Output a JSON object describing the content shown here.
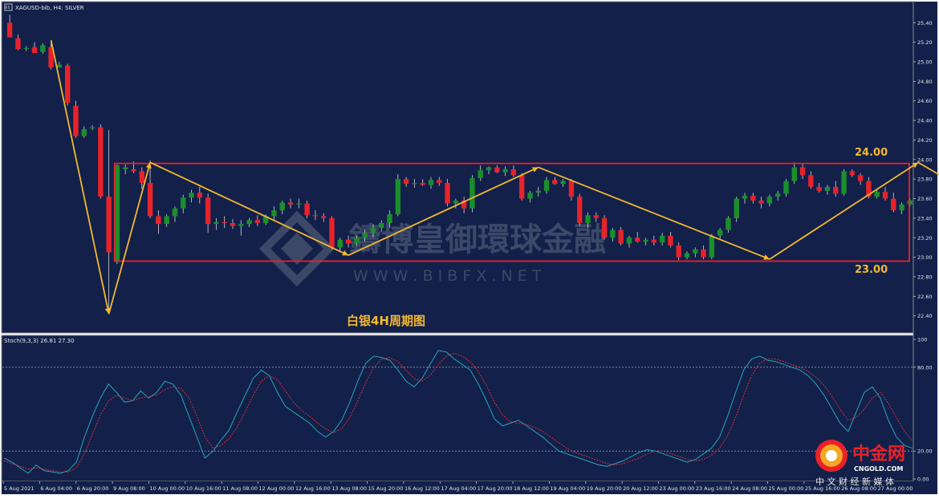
{
  "window": {
    "symbol_line": "XAGUSD-bib, H4:  SILVER",
    "stoch_line": "Stoch(9,3,3) 26.81 27.30"
  },
  "annotations": {
    "upper_label": "24.00",
    "lower_label": "23.00",
    "chart_title": "白银4H周期图"
  },
  "watermark": {
    "brand": "鑄博皇御環球金融",
    "url": "W W W . B I B F X . N E T"
  },
  "logo": {
    "name": "中金网",
    "domain": "CNGOLD.COM",
    "tagline": "中 文 财 经 新 媒 体"
  },
  "colors": {
    "background": "#12204a",
    "grid_dot": "#c8c8c8",
    "bull_candle": "#1a8f2a",
    "bear_candle": "#e8222a",
    "range_box": "#e8222a",
    "zigzag": "#f5b82e",
    "stoch_main": "#2aa6b8",
    "stoch_signal": "#d9323a"
  },
  "chart_data": [
    {
      "type": "candlestick",
      "title": "白银4H周期图",
      "symbol": "XAGUSD-bib, H4:  SILVER",
      "ylim": [
        22.25,
        25.55
      ],
      "y_ticks": [
        "25.40",
        "25.20",
        "25.00",
        "24.80",
        "24.60",
        "24.40",
        "24.20",
        "24.00",
        "23.80",
        "23.60",
        "23.40",
        "23.20",
        "23.00",
        "22.80",
        "22.60",
        "22.40"
      ],
      "x_tick_labels": [
        "5 Aug 2021",
        "6 Aug 04:00",
        "6 Aug 20:00",
        "9 Aug 08:00",
        "10 Aug 00:00",
        "10 Aug 16:00",
        "11 Aug 08:00",
        "12 Aug 00:00",
        "12 Aug 16:00",
        "13 Aug 08:00",
        "15 Aug 20:00",
        "16 Aug 12:00",
        "17 Aug 04:00",
        "17 Aug 20:00",
        "18 Aug 12:00",
        "19 Aug 04:00",
        "19 Aug 20:00",
        "20 Aug 12:00",
        "23 Aug 00:00",
        "23 Aug 16:00",
        "24 Aug 08:00",
        "25 Aug 00:00",
        "25 Aug 16:00",
        "26 Aug 08:00",
        "27 Aug 00:00"
      ],
      "range_box": {
        "high": 23.96,
        "low": 22.96
      },
      "levels": [
        {
          "label": "24.00",
          "value": 24.0
        },
        {
          "label": "23.00",
          "value": 23.0
        }
      ],
      "zigzag": [
        {
          "bar": 5,
          "price": 25.22
        },
        {
          "bar": 12,
          "price": 22.42
        },
        {
          "bar": 17,
          "price": 23.97
        },
        {
          "bar": 41,
          "price": 23.02
        },
        {
          "bar": 64,
          "price": 23.92
        },
        {
          "bar": 92,
          "price": 22.98
        },
        {
          "bar": 110,
          "price": 23.97
        },
        {
          "bar": 130,
          "price": 22.98
        },
        {
          "bar": 135,
          "price": 23.75
        }
      ],
      "candles": [
        {
          "o": 25.4,
          "h": 25.48,
          "l": 25.25,
          "c": 25.25
        },
        {
          "o": 25.24,
          "h": 25.28,
          "l": 25.12,
          "c": 25.13
        },
        {
          "o": 25.14,
          "h": 25.16,
          "l": 25.11,
          "c": 25.14
        },
        {
          "o": 25.15,
          "h": 25.2,
          "l": 25.09,
          "c": 25.09
        },
        {
          "o": 25.1,
          "h": 25.19,
          "l": 25.08,
          "c": 25.17
        },
        {
          "o": 25.15,
          "h": 25.2,
          "l": 24.92,
          "c": 24.94
        },
        {
          "o": 24.94,
          "h": 25.0,
          "l": 24.95,
          "c": 24.97
        },
        {
          "o": 24.96,
          "h": 24.98,
          "l": 24.55,
          "c": 24.58
        },
        {
          "o": 24.55,
          "h": 24.6,
          "l": 24.22,
          "c": 24.24
        },
        {
          "o": 24.24,
          "h": 24.34,
          "l": 24.22,
          "c": 24.31
        },
        {
          "o": 24.32,
          "h": 24.35,
          "l": 24.3,
          "c": 24.33
        },
        {
          "o": 24.33,
          "h": 24.36,
          "l": 23.6,
          "c": 23.62
        },
        {
          "o": 23.62,
          "h": 24.3,
          "l": 22.42,
          "c": 23.05
        },
        {
          "o": 22.95,
          "h": 23.95,
          "l": 22.93,
          "c": 23.94
        },
        {
          "o": 23.9,
          "h": 23.95,
          "l": 23.85,
          "c": 23.92
        },
        {
          "o": 23.9,
          "h": 23.98,
          "l": 23.86,
          "c": 23.88
        },
        {
          "o": 23.88,
          "h": 23.92,
          "l": 23.7,
          "c": 23.76
        },
        {
          "o": 23.76,
          "h": 23.99,
          "l": 23.4,
          "c": 23.42
        },
        {
          "o": 23.42,
          "h": 23.48,
          "l": 23.24,
          "c": 23.34
        },
        {
          "o": 23.34,
          "h": 23.44,
          "l": 23.31,
          "c": 23.42
        },
        {
          "o": 23.42,
          "h": 23.52,
          "l": 23.36,
          "c": 23.5
        },
        {
          "o": 23.5,
          "h": 23.64,
          "l": 23.45,
          "c": 23.61
        },
        {
          "o": 23.61,
          "h": 23.69,
          "l": 23.56,
          "c": 23.66
        },
        {
          "o": 23.66,
          "h": 23.72,
          "l": 23.55,
          "c": 23.61
        },
        {
          "o": 23.61,
          "h": 23.65,
          "l": 23.25,
          "c": 23.34
        },
        {
          "o": 23.34,
          "h": 23.4,
          "l": 23.28,
          "c": 23.36
        },
        {
          "o": 23.36,
          "h": 23.42,
          "l": 23.3,
          "c": 23.35
        },
        {
          "o": 23.35,
          "h": 23.39,
          "l": 23.29,
          "c": 23.32
        },
        {
          "o": 23.32,
          "h": 23.38,
          "l": 23.22,
          "c": 23.34
        },
        {
          "o": 23.34,
          "h": 23.4,
          "l": 23.31,
          "c": 23.38
        },
        {
          "o": 23.38,
          "h": 23.43,
          "l": 23.32,
          "c": 23.35
        },
        {
          "o": 23.35,
          "h": 23.44,
          "l": 23.33,
          "c": 23.42
        },
        {
          "o": 23.42,
          "h": 23.52,
          "l": 23.38,
          "c": 23.48
        },
        {
          "o": 23.48,
          "h": 23.58,
          "l": 23.44,
          "c": 23.56
        },
        {
          "o": 23.56,
          "h": 23.6,
          "l": 23.5,
          "c": 23.54
        },
        {
          "o": 23.54,
          "h": 23.6,
          "l": 23.5,
          "c": 23.55
        },
        {
          "o": 23.55,
          "h": 23.58,
          "l": 23.4,
          "c": 23.43
        },
        {
          "o": 23.43,
          "h": 23.48,
          "l": 23.38,
          "c": 23.42
        },
        {
          "o": 23.42,
          "h": 23.45,
          "l": 23.36,
          "c": 23.4
        },
        {
          "o": 23.4,
          "h": 23.42,
          "l": 23.08,
          "c": 23.1
        },
        {
          "o": 23.1,
          "h": 23.2,
          "l": 23.05,
          "c": 23.18
        },
        {
          "o": 23.18,
          "h": 23.22,
          "l": 23.1,
          "c": 23.14
        },
        {
          "o": 23.14,
          "h": 23.22,
          "l": 23.12,
          "c": 23.2
        },
        {
          "o": 23.2,
          "h": 23.28,
          "l": 23.16,
          "c": 23.25
        },
        {
          "o": 23.25,
          "h": 23.34,
          "l": 23.2,
          "c": 23.3
        },
        {
          "o": 23.3,
          "h": 23.38,
          "l": 23.26,
          "c": 23.35
        },
        {
          "o": 23.35,
          "h": 23.48,
          "l": 23.3,
          "c": 23.44
        },
        {
          "o": 23.44,
          "h": 23.85,
          "l": 23.42,
          "c": 23.8
        },
        {
          "o": 23.8,
          "h": 23.82,
          "l": 23.72,
          "c": 23.75
        },
        {
          "o": 23.75,
          "h": 23.8,
          "l": 23.71,
          "c": 23.76
        },
        {
          "o": 23.76,
          "h": 23.8,
          "l": 23.73,
          "c": 23.74
        },
        {
          "o": 23.74,
          "h": 23.82,
          "l": 23.7,
          "c": 23.79
        },
        {
          "o": 23.79,
          "h": 23.82,
          "l": 23.73,
          "c": 23.76
        },
        {
          "o": 23.76,
          "h": 23.8,
          "l": 23.52,
          "c": 23.55
        },
        {
          "o": 23.55,
          "h": 23.6,
          "l": 23.5,
          "c": 23.58
        },
        {
          "o": 23.58,
          "h": 23.62,
          "l": 23.45,
          "c": 23.5
        },
        {
          "o": 23.5,
          "h": 23.84,
          "l": 23.46,
          "c": 23.81
        },
        {
          "o": 23.81,
          "h": 23.94,
          "l": 23.78,
          "c": 23.89
        },
        {
          "o": 23.89,
          "h": 23.93,
          "l": 23.85,
          "c": 23.92
        },
        {
          "o": 23.92,
          "h": 23.94,
          "l": 23.86,
          "c": 23.87
        },
        {
          "o": 23.87,
          "h": 23.93,
          "l": 23.83,
          "c": 23.9
        },
        {
          "o": 23.9,
          "h": 23.94,
          "l": 23.82,
          "c": 23.84
        },
        {
          "o": 23.84,
          "h": 23.86,
          "l": 23.58,
          "c": 23.6
        },
        {
          "o": 23.6,
          "h": 23.68,
          "l": 23.56,
          "c": 23.66
        },
        {
          "o": 23.66,
          "h": 23.72,
          "l": 23.62,
          "c": 23.68
        },
        {
          "o": 23.68,
          "h": 23.82,
          "l": 23.65,
          "c": 23.79
        },
        {
          "o": 23.79,
          "h": 23.82,
          "l": 23.74,
          "c": 23.75
        },
        {
          "o": 23.75,
          "h": 23.8,
          "l": 23.72,
          "c": 23.78
        },
        {
          "o": 23.78,
          "h": 23.8,
          "l": 23.58,
          "c": 23.62
        },
        {
          "o": 23.62,
          "h": 23.65,
          "l": 23.32,
          "c": 23.35
        },
        {
          "o": 23.35,
          "h": 23.46,
          "l": 23.3,
          "c": 23.43
        },
        {
          "o": 23.43,
          "h": 23.46,
          "l": 23.36,
          "c": 23.4
        },
        {
          "o": 23.4,
          "h": 23.43,
          "l": 23.18,
          "c": 23.2
        },
        {
          "o": 23.2,
          "h": 23.3,
          "l": 23.16,
          "c": 23.28
        },
        {
          "o": 23.28,
          "h": 23.31,
          "l": 23.12,
          "c": 23.14
        },
        {
          "o": 23.14,
          "h": 23.22,
          "l": 23.1,
          "c": 23.2
        },
        {
          "o": 23.2,
          "h": 23.26,
          "l": 23.15,
          "c": 23.16
        },
        {
          "o": 23.16,
          "h": 23.2,
          "l": 23.12,
          "c": 23.18
        },
        {
          "o": 23.18,
          "h": 23.22,
          "l": 23.12,
          "c": 23.15
        },
        {
          "o": 23.15,
          "h": 23.25,
          "l": 23.12,
          "c": 23.22
        },
        {
          "o": 23.22,
          "h": 23.26,
          "l": 23.1,
          "c": 23.12
        },
        {
          "o": 23.12,
          "h": 23.15,
          "l": 22.97,
          "c": 23.0
        },
        {
          "o": 23.0,
          "h": 23.06,
          "l": 22.98,
          "c": 23.04
        },
        {
          "o": 23.04,
          "h": 23.1,
          "l": 23.0,
          "c": 23.08
        },
        {
          "o": 23.08,
          "h": 23.12,
          "l": 22.98,
          "c": 23.0
        },
        {
          "o": 23.0,
          "h": 23.24,
          "l": 22.98,
          "c": 23.22
        },
        {
          "o": 23.22,
          "h": 23.3,
          "l": 23.18,
          "c": 23.28
        },
        {
          "o": 23.28,
          "h": 23.42,
          "l": 23.25,
          "c": 23.4
        },
        {
          "o": 23.4,
          "h": 23.62,
          "l": 23.36,
          "c": 23.6
        },
        {
          "o": 23.6,
          "h": 23.66,
          "l": 23.55,
          "c": 23.63
        },
        {
          "o": 23.63,
          "h": 23.66,
          "l": 23.55,
          "c": 23.58
        },
        {
          "o": 23.58,
          "h": 23.62,
          "l": 23.5,
          "c": 23.55
        },
        {
          "o": 23.55,
          "h": 23.64,
          "l": 23.52,
          "c": 23.62
        },
        {
          "o": 23.62,
          "h": 23.68,
          "l": 23.58,
          "c": 23.65
        },
        {
          "o": 23.65,
          "h": 23.8,
          "l": 23.62,
          "c": 23.78
        },
        {
          "o": 23.78,
          "h": 23.97,
          "l": 23.75,
          "c": 23.92
        },
        {
          "o": 23.92,
          "h": 23.96,
          "l": 23.8,
          "c": 23.84
        },
        {
          "o": 23.84,
          "h": 23.88,
          "l": 23.7,
          "c": 23.72
        },
        {
          "o": 23.72,
          "h": 23.76,
          "l": 23.66,
          "c": 23.68
        },
        {
          "o": 23.68,
          "h": 23.74,
          "l": 23.64,
          "c": 23.72
        },
        {
          "o": 23.72,
          "h": 23.78,
          "l": 23.62,
          "c": 23.65
        },
        {
          "o": 23.65,
          "h": 23.9,
          "l": 23.63,
          "c": 23.88
        },
        {
          "o": 23.88,
          "h": 23.9,
          "l": 23.82,
          "c": 23.84
        },
        {
          "o": 23.84,
          "h": 23.86,
          "l": 23.74,
          "c": 23.78
        },
        {
          "o": 23.78,
          "h": 23.82,
          "l": 23.6,
          "c": 23.62
        },
        {
          "o": 23.62,
          "h": 23.7,
          "l": 23.6,
          "c": 23.67
        },
        {
          "o": 23.67,
          "h": 23.72,
          "l": 23.58,
          "c": 23.6
        },
        {
          "o": 23.6,
          "h": 23.66,
          "l": 23.46,
          "c": 23.48
        },
        {
          "o": 23.48,
          "h": 23.56,
          "l": 23.44,
          "c": 23.54
        },
        {
          "o": 23.54,
          "h": 23.6,
          "l": 23.52,
          "c": 23.58
        }
      ]
    },
    {
      "type": "line",
      "title": "Stoch(9,3,3) 26.81 27.30",
      "ylim": [
        0,
        100
      ],
      "y_ticks": [
        "100",
        "80.00",
        "20.00",
        "0.00"
      ],
      "levels": [
        80,
        20
      ],
      "series": [
        {
          "name": "Stoch main",
          "values": [
            15,
            12,
            8,
            4,
            10,
            6,
            5,
            4,
            6,
            12,
            30,
            45,
            58,
            68,
            62,
            55,
            56,
            63,
            58,
            62,
            70,
            68,
            60,
            45,
            30,
            15,
            20,
            28,
            35,
            48,
            60,
            72,
            78,
            74,
            62,
            52,
            48,
            44,
            40,
            34,
            30,
            34,
            42,
            55,
            70,
            83,
            88,
            87,
            85,
            78,
            70,
            66,
            72,
            82,
            92,
            91,
            86,
            82,
            78,
            68,
            56,
            43,
            38,
            40,
            42,
            38,
            34,
            30,
            25,
            20,
            18,
            16,
            14,
            12,
            10,
            9,
            11,
            13,
            16,
            19,
            21,
            20,
            18,
            16,
            14,
            12,
            14,
            18,
            22,
            30,
            45,
            62,
            78,
            86,
            88,
            85,
            84,
            82,
            80,
            78,
            74,
            68,
            60,
            50,
            40,
            34,
            48,
            62,
            66,
            58,
            42,
            30,
            24,
            22
          ]
        },
        {
          "name": "Stoch signal",
          "values": [
            13,
            11,
            9,
            7,
            8,
            7,
            6,
            5,
            5,
            8,
            18,
            32,
            46,
            56,
            60,
            58,
            56,
            58,
            59,
            60,
            64,
            66,
            65,
            58,
            45,
            30,
            22,
            24,
            29,
            37,
            48,
            60,
            70,
            74,
            71,
            63,
            55,
            49,
            45,
            40,
            36,
            33,
            36,
            44,
            56,
            69,
            80,
            86,
            87,
            84,
            78,
            72,
            70,
            74,
            82,
            88,
            90,
            88,
            84,
            77,
            67,
            55,
            46,
            41,
            40,
            39,
            37,
            34,
            30,
            26,
            22,
            19,
            17,
            15,
            13,
            11,
            10,
            11,
            13,
            15,
            18,
            20,
            20,
            18,
            16,
            14,
            13,
            14,
            17,
            22,
            31,
            44,
            60,
            74,
            83,
            86,
            86,
            84,
            82,
            80,
            77,
            73,
            67,
            59,
            50,
            42,
            44,
            50,
            58,
            62,
            54,
            44,
            34,
            27
          ]
        }
      ]
    }
  ]
}
